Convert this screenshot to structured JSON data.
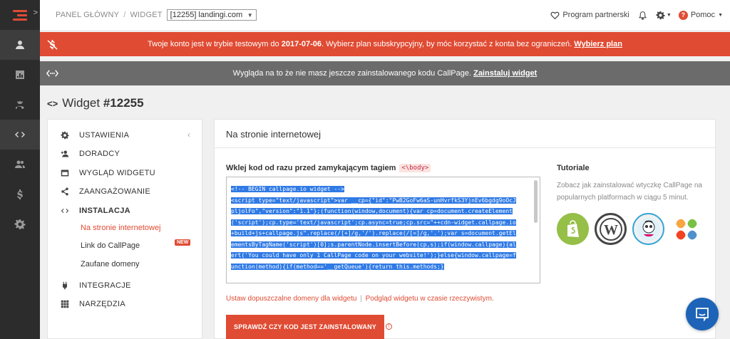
{
  "breadcrumb": {
    "home": "PANEL GŁÓWNY",
    "separator": "/",
    "widget": "WIDGET",
    "selected_widget": "[12255] landingi.com"
  },
  "topbar": {
    "partner_label": "Program partnerski",
    "help_label": "Pomoc"
  },
  "banners": {
    "trial": {
      "text_before": "Twoje konto jest w trybie testowym do ",
      "date": "2017-07-06",
      "text_after": ". Wybierz plan subskrypcyjny, by móc korzystać z konta bez ograniczeń. ",
      "link": "Wybierz plan"
    },
    "install": {
      "text": "Wygląda na to że nie masz jeszcze zainstalowanego kodu CallPage. ",
      "link": "Zainstaluj widget"
    }
  },
  "page": {
    "icon": "<>",
    "title_prefix": "Widget ",
    "title_id": "#12255"
  },
  "menu": {
    "items": [
      {
        "label": "USTAWIENIA",
        "icon": "gear-icon"
      },
      {
        "label": "DORADCY",
        "icon": "add-person-icon"
      },
      {
        "label": "WYGLĄD WIDGETU",
        "icon": "window-icon"
      },
      {
        "label": "ZAANGAŻOWANIE",
        "icon": "share-icon"
      },
      {
        "label": "INSTALACJA",
        "icon": "code-icon"
      },
      {
        "label": "INTEGRACJE",
        "icon": "plug-icon"
      },
      {
        "label": "NARZĘDZIA",
        "icon": "grid-icon"
      }
    ],
    "subitems": [
      {
        "label": "Na stronie internetowej",
        "active": true
      },
      {
        "label": "Link do CallPage",
        "badge": "NEW"
      },
      {
        "label": "Zaufane domeny"
      }
    ]
  },
  "main": {
    "section_title": "Na stronie internetowej",
    "paste_label": "Wklej kod od razu przed zamykającym tagiem",
    "body_tag": "<\\body>",
    "code_lines": [
      "<!-- BEGIN callpage.io widget -->",
      "<script type=\"text/javascript\">var __cp={\"id\":\"PwB2GoFw6aS-unHvrfkS3YjnEv6bgdg9oOcJ",
      "pljolFo\",\"version\":\"1.1\"};(function(window,document){var cp=document.createElement",
      "('script');cp.type='text/javascript';cp.async=true;cp.src=\"++cdn-widget.callpage.io",
      "+build+js+callpage.js\".replace(/[+]/g,'/').replace(/[=]/g,'.');var s=document.getEl",
      "ementsByTagName('script')[0];s.parentNode.insertBefore(cp,s);if(window.callpage){al",
      "ert('You could have only 1 CallPage code on your website!');}else{window.callpage=f",
      "unction(method){if(method=='__getQueue'){return this.methods;}"
    ],
    "domains_link": "Ustaw dopuszczalne domeny dla widgetu",
    "domains_sep": "|",
    "preview_link": "Podgląd widgetu w czasie rzeczywistym.",
    "verify_button": "SPRAWDŹ CZY KOD JEST ZAINSTALOWANY",
    "tutorials": {
      "title": "Tutoriale",
      "description": "Zobacz jak zainstalować wtyczkę CallPage na popularnych platformach w ciągu 5 minut.",
      "platforms": [
        "shopify-icon",
        "wordpress-icon",
        "prestashop-icon",
        "joomla-icon"
      ]
    }
  },
  "colors": {
    "accent": "#e04b33",
    "rail": "#2c2c2c",
    "gray_banner": "#6b6b6b",
    "chat": "#1d64b8",
    "code_highlight": "#2f7ae5"
  }
}
